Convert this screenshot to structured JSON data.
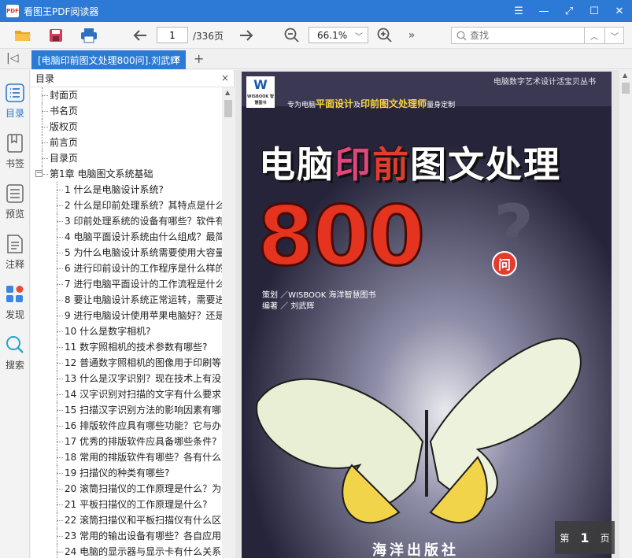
{
  "app": {
    "logo_text": "PDF",
    "title": "看图王PDF阅读器",
    "window_controls": {
      "menu": "☰",
      "minimize": "—",
      "fullscreen": "⤢",
      "maximize": "☐",
      "close": "✕"
    }
  },
  "toolbar": {
    "page_current": "1",
    "page_total": "/336页",
    "zoom": "66.1%",
    "more": "»",
    "search_placeholder": "查找",
    "icons": [
      "open-folder-icon",
      "save-icon",
      "print-icon",
      "arrow-left-icon",
      "arrow-right-icon",
      "zoom-out-icon",
      "zoom-in-icon",
      "more-icon",
      "search-icon"
    ]
  },
  "tabs": {
    "collapse": "|◁",
    "items": [
      {
        "label": "[电脑印前图文处理800问].刘武辉",
        "close": "✕"
      }
    ],
    "add": "+"
  },
  "rail": [
    {
      "label": "目录",
      "icon": "list-icon",
      "active": true
    },
    {
      "label": "书签",
      "icon": "bookmark-icon",
      "active": false
    },
    {
      "label": "预览",
      "icon": "thumbnails-icon",
      "active": false
    },
    {
      "label": "注释",
      "icon": "annotation-icon",
      "active": false
    },
    {
      "label": "发现",
      "icon": "discover-icon",
      "active": false
    },
    {
      "label": "搜索",
      "icon": "search-icon",
      "active": false
    }
  ],
  "toc": {
    "header": "目录",
    "close": "×",
    "items": [
      {
        "text": "封面页",
        "level": 0
      },
      {
        "text": "书名页",
        "level": 0
      },
      {
        "text": "版权页",
        "level": 0
      },
      {
        "text": "前言页",
        "level": 0
      },
      {
        "text": "目录页",
        "level": 0
      },
      {
        "text": "第1章 电脑图文系统基础",
        "level": "chapter"
      },
      {
        "text": "1 什么是电脑设计系统?",
        "level": 1
      },
      {
        "text": "2 什么是印前处理系统？其特点是什么",
        "level": 1
      },
      {
        "text": "3 印前处理系统的设备有哪些？软件有",
        "level": 1
      },
      {
        "text": "4 电脑平面设计系统由什么组成？最简",
        "level": 1
      },
      {
        "text": "5 为什么电脑设计系统需要使用大容量",
        "level": 1
      },
      {
        "text": "6 进行印前设计的工作程序是什么样的",
        "level": 1
      },
      {
        "text": "7 进行电脑平面设计的工作流程是什么",
        "level": 1
      },
      {
        "text": "8 要让电脑设计系统正常运转，需要进",
        "level": 1
      },
      {
        "text": "9 进行电脑设计使用苹果电脑好？还是",
        "level": 1
      },
      {
        "text": "10 什么是数字相机?",
        "level": 1
      },
      {
        "text": "11 数字照相机的技术参数有哪些?",
        "level": 1
      },
      {
        "text": "12 普通数字照相机的图像用于印刷等",
        "level": 1
      },
      {
        "text": "13 什么是汉字识别？现在技术上有没",
        "level": 1
      },
      {
        "text": "14 汉字识别对扫描的文字有什么要求",
        "level": 1
      },
      {
        "text": "15 扫描汉字识别方法的影响因素有哪",
        "level": 1
      },
      {
        "text": "16 排版软件应具有哪些功能？它与办",
        "level": 1
      },
      {
        "text": "17 优秀的排版软件应具备哪些条件?",
        "level": 1
      },
      {
        "text": "18 常用的排版软件有哪些？各有什么",
        "level": 1
      },
      {
        "text": "19 扫描仪的种类有哪些?",
        "level": 1
      },
      {
        "text": "20 滚筒扫描仪的工作原理是什么？为",
        "level": 1
      },
      {
        "text": "21 平板扫描仪的工作原理是什么?",
        "level": 1
      },
      {
        "text": "22 滚筒扫描仪和平板扫描仪有什么区",
        "level": 1
      },
      {
        "text": "23 常用的输出设备有哪些？各自应用",
        "level": 1
      },
      {
        "text": "24 电脑的显示器与显示卡有什么关系",
        "level": 1
      }
    ]
  },
  "cover": {
    "logo_main": "W",
    "logo_sub": "WISBOOK 智慧图书",
    "series": "电脑数字艺术设计活宝贝丛书",
    "tagline_pre": "专为电脑",
    "tagline_a": "平面设计",
    "tagline_mid": "及",
    "tagline_b": "印前图文处理师",
    "tagline_post": "量身定制",
    "title_a": "电脑",
    "title_b": "印",
    "title_c": "前",
    "title_d": "图文处理",
    "number": "800",
    "question_mark": "?",
    "wen": "问",
    "credit_1": "策划 ／WISBOOK 海洋智慧图书",
    "credit_2": "编著 ／ 刘武辉",
    "publisher": "海洋出版社"
  },
  "page_badge": {
    "prefix": "第",
    "number": "1",
    "suffix": "页"
  }
}
